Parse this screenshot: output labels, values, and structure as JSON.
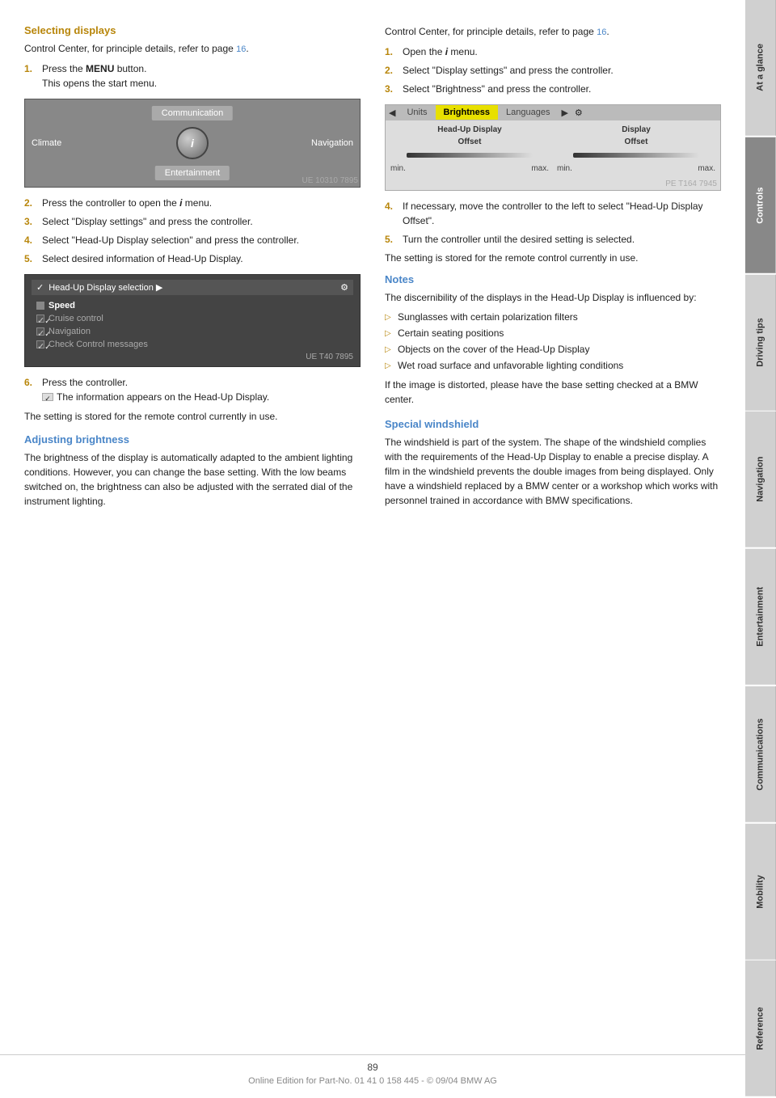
{
  "sidebar": {
    "tabs": [
      {
        "id": "at-a-glance",
        "label": "At a glance",
        "active": false
      },
      {
        "id": "controls",
        "label": "Controls",
        "active": true
      },
      {
        "id": "driving-tips",
        "label": "Driving tips",
        "active": false
      },
      {
        "id": "navigation",
        "label": "Navigation",
        "active": false
      },
      {
        "id": "entertainment",
        "label": "Entertainment",
        "active": false
      },
      {
        "id": "communications",
        "label": "Communications",
        "active": false
      },
      {
        "id": "mobility",
        "label": "Mobility",
        "active": false
      },
      {
        "id": "reference",
        "label": "Reference",
        "active": false
      }
    ]
  },
  "left_col": {
    "section1": {
      "heading": "Selecting displays",
      "intro": "Control Center, for principle details, refer to page 16.",
      "page_ref": "16",
      "steps": [
        {
          "num": "1.",
          "text": "Press the MENU button.\nThis opens the start menu."
        },
        {
          "num": "2.",
          "text": "Press the controller to open the i menu."
        },
        {
          "num": "3.",
          "text": "Select \"Display settings\" and press the controller."
        },
        {
          "num": "4.",
          "text": "Select \"Head-Up Display selection\" and press the controller."
        },
        {
          "num": "5.",
          "text": "Select desired information of Head-Up Display."
        },
        {
          "num": "6.",
          "text": "Press the controller.\nThe information appears on the Head-Up Display."
        }
      ],
      "stored_note": "The setting is stored for the remote control currently in use.",
      "menu_labels": {
        "communication": "Communication",
        "climate": "Climate",
        "navigation": "Navigation",
        "entertainment": "Entertainment"
      },
      "hud": {
        "title": "Head-Up Display selection",
        "items": [
          {
            "label": "Speed",
            "type": "square",
            "checked": false
          },
          {
            "label": "Cruise control",
            "type": "check",
            "checked": true
          },
          {
            "label": "Navigation",
            "type": "check",
            "checked": true
          },
          {
            "label": "Check Control messages",
            "type": "check",
            "checked": true
          }
        ]
      }
    },
    "section2": {
      "heading": "Adjusting brightness",
      "text": "The brightness of the display is automatically adapted to the ambient lighting conditions. However, you can change the base setting. With the low beams switched on, the brightness can also be adjusted with the serrated dial of the instrument lighting."
    }
  },
  "right_col": {
    "intro": "Control Center, for principle details, refer to page 16.",
    "page_ref": "16",
    "steps": [
      {
        "num": "1.",
        "text": "Open the i menu."
      },
      {
        "num": "2.",
        "text": "Select \"Display settings\" and press the controller."
      },
      {
        "num": "3.",
        "text": "Select \"Brightness\" and press the controller."
      },
      {
        "num": "4.",
        "text": "If necessary, move the controller to the left to select \"Head-Up Display Offset\"."
      },
      {
        "num": "5.",
        "text": "Turn the controller until the desired setting is selected."
      }
    ],
    "stored_note": "The setting is stored for the remote control currently in use.",
    "brightness": {
      "tabs": [
        "Units",
        "Brightness",
        "Languages"
      ],
      "active_tab": "Brightness",
      "cols": [
        {
          "label1": "Head-Up Display",
          "label2": "Offset",
          "min": "min.",
          "max": "max."
        },
        {
          "label1": "Display",
          "label2": "Offset",
          "min": "min.",
          "max": "max."
        }
      ]
    },
    "notes": {
      "heading": "Notes",
      "intro": "The discernibility of the displays in the Head-Up Display is influenced by:",
      "items": [
        "Sunglasses with certain polarization filters",
        "Certain seating positions",
        "Objects on the cover of the Head-Up Display",
        "Wet road surface and unfavorable lighting conditions"
      ],
      "distortion_note": "If the image is distorted, please have the base setting checked at a BMW center."
    },
    "special_windshield": {
      "heading": "Special windshield",
      "text": "The windshield is part of the system. The shape of the windshield complies with the requirements of the Head-Up Display to enable a precise display. A film in the windshield prevents the double images from being displayed. Only have a windshield replaced by a BMW center or a workshop which works with personnel trained in accordance with BMW specifications."
    }
  },
  "footer": {
    "page": "89",
    "copyright": "Online Edition for Part-No. 01 41 0 158 445 - © 09/04 BMW AG"
  }
}
